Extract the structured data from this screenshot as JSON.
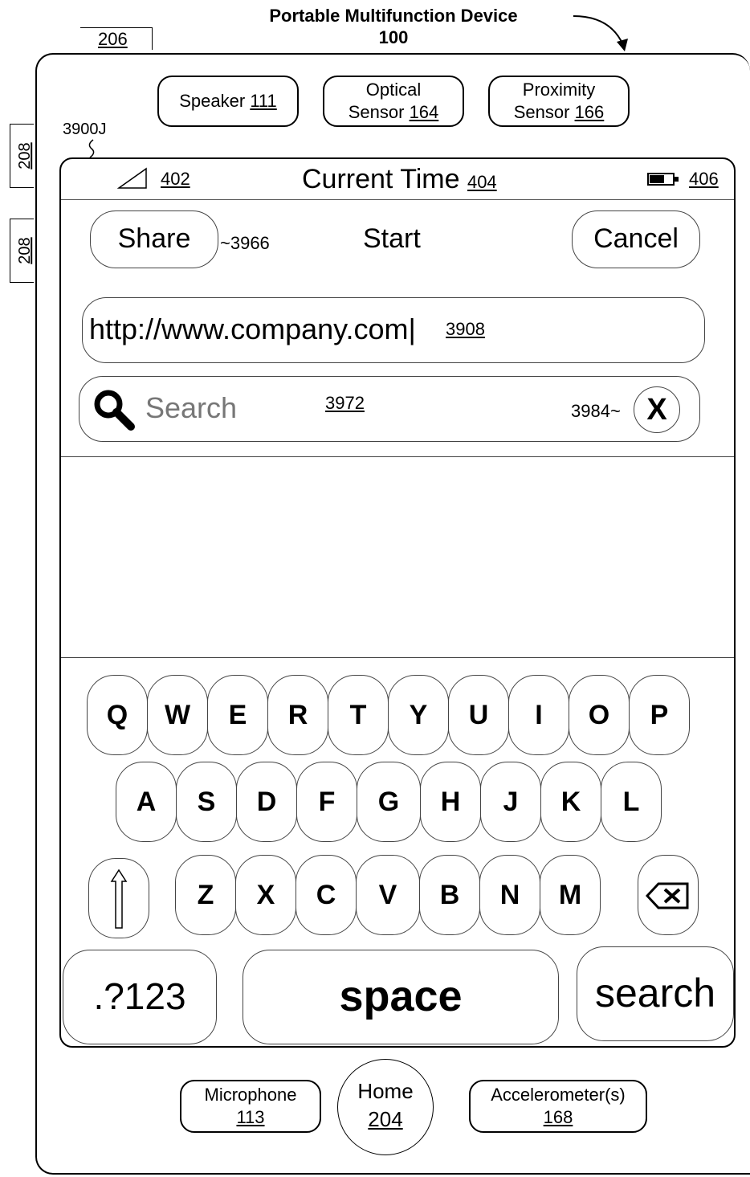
{
  "device": {
    "title_line1": "Portable Multifunction Device",
    "title_line2": "100",
    "ref_top": "206",
    "ref_side_1": "208",
    "ref_side_2": "208",
    "speaker": {
      "label": "Speaker",
      "ref": "111"
    },
    "optical_sensor": {
      "line1": "Optical",
      "line2": "Sensor",
      "ref": "164"
    },
    "proximity_sensor": {
      "line1": "Proximity",
      "line2": "Sensor",
      "ref": "166"
    },
    "microphone": {
      "label": "Microphone",
      "ref": "113"
    },
    "home": {
      "label": "Home",
      "ref": "204"
    },
    "accelerometer": {
      "label": "Accelerometer(s)",
      "ref": "168"
    }
  },
  "screen": {
    "ref": "3900J",
    "status_bar": {
      "signal_ref": "402",
      "time": "Current Time",
      "time_ref": "404",
      "battery_ref": "406"
    },
    "nav": {
      "share_label": "Share",
      "share_ref": "~3966",
      "title": "Start",
      "cancel_label": "Cancel"
    },
    "url_field": {
      "value": "http://www.company.com|",
      "ref": "3908"
    },
    "search_field": {
      "placeholder": "Search",
      "ref": "3972",
      "clear_ref": "3984~",
      "clear_label": "X"
    }
  },
  "keyboard": {
    "row1": [
      "Q",
      "W",
      "E",
      "R",
      "T",
      "Y",
      "U",
      "I",
      "O",
      "P"
    ],
    "row2": [
      "A",
      "S",
      "D",
      "F",
      "G",
      "H",
      "J",
      "K",
      "L"
    ],
    "row3": [
      "Z",
      "X",
      "C",
      "V",
      "B",
      "N",
      "M"
    ],
    "numbers_label": ".?123",
    "space_label": "space",
    "search_label": "search",
    "shift_icon": "shift-arrow-icon",
    "backspace_icon": "backspace-icon"
  }
}
